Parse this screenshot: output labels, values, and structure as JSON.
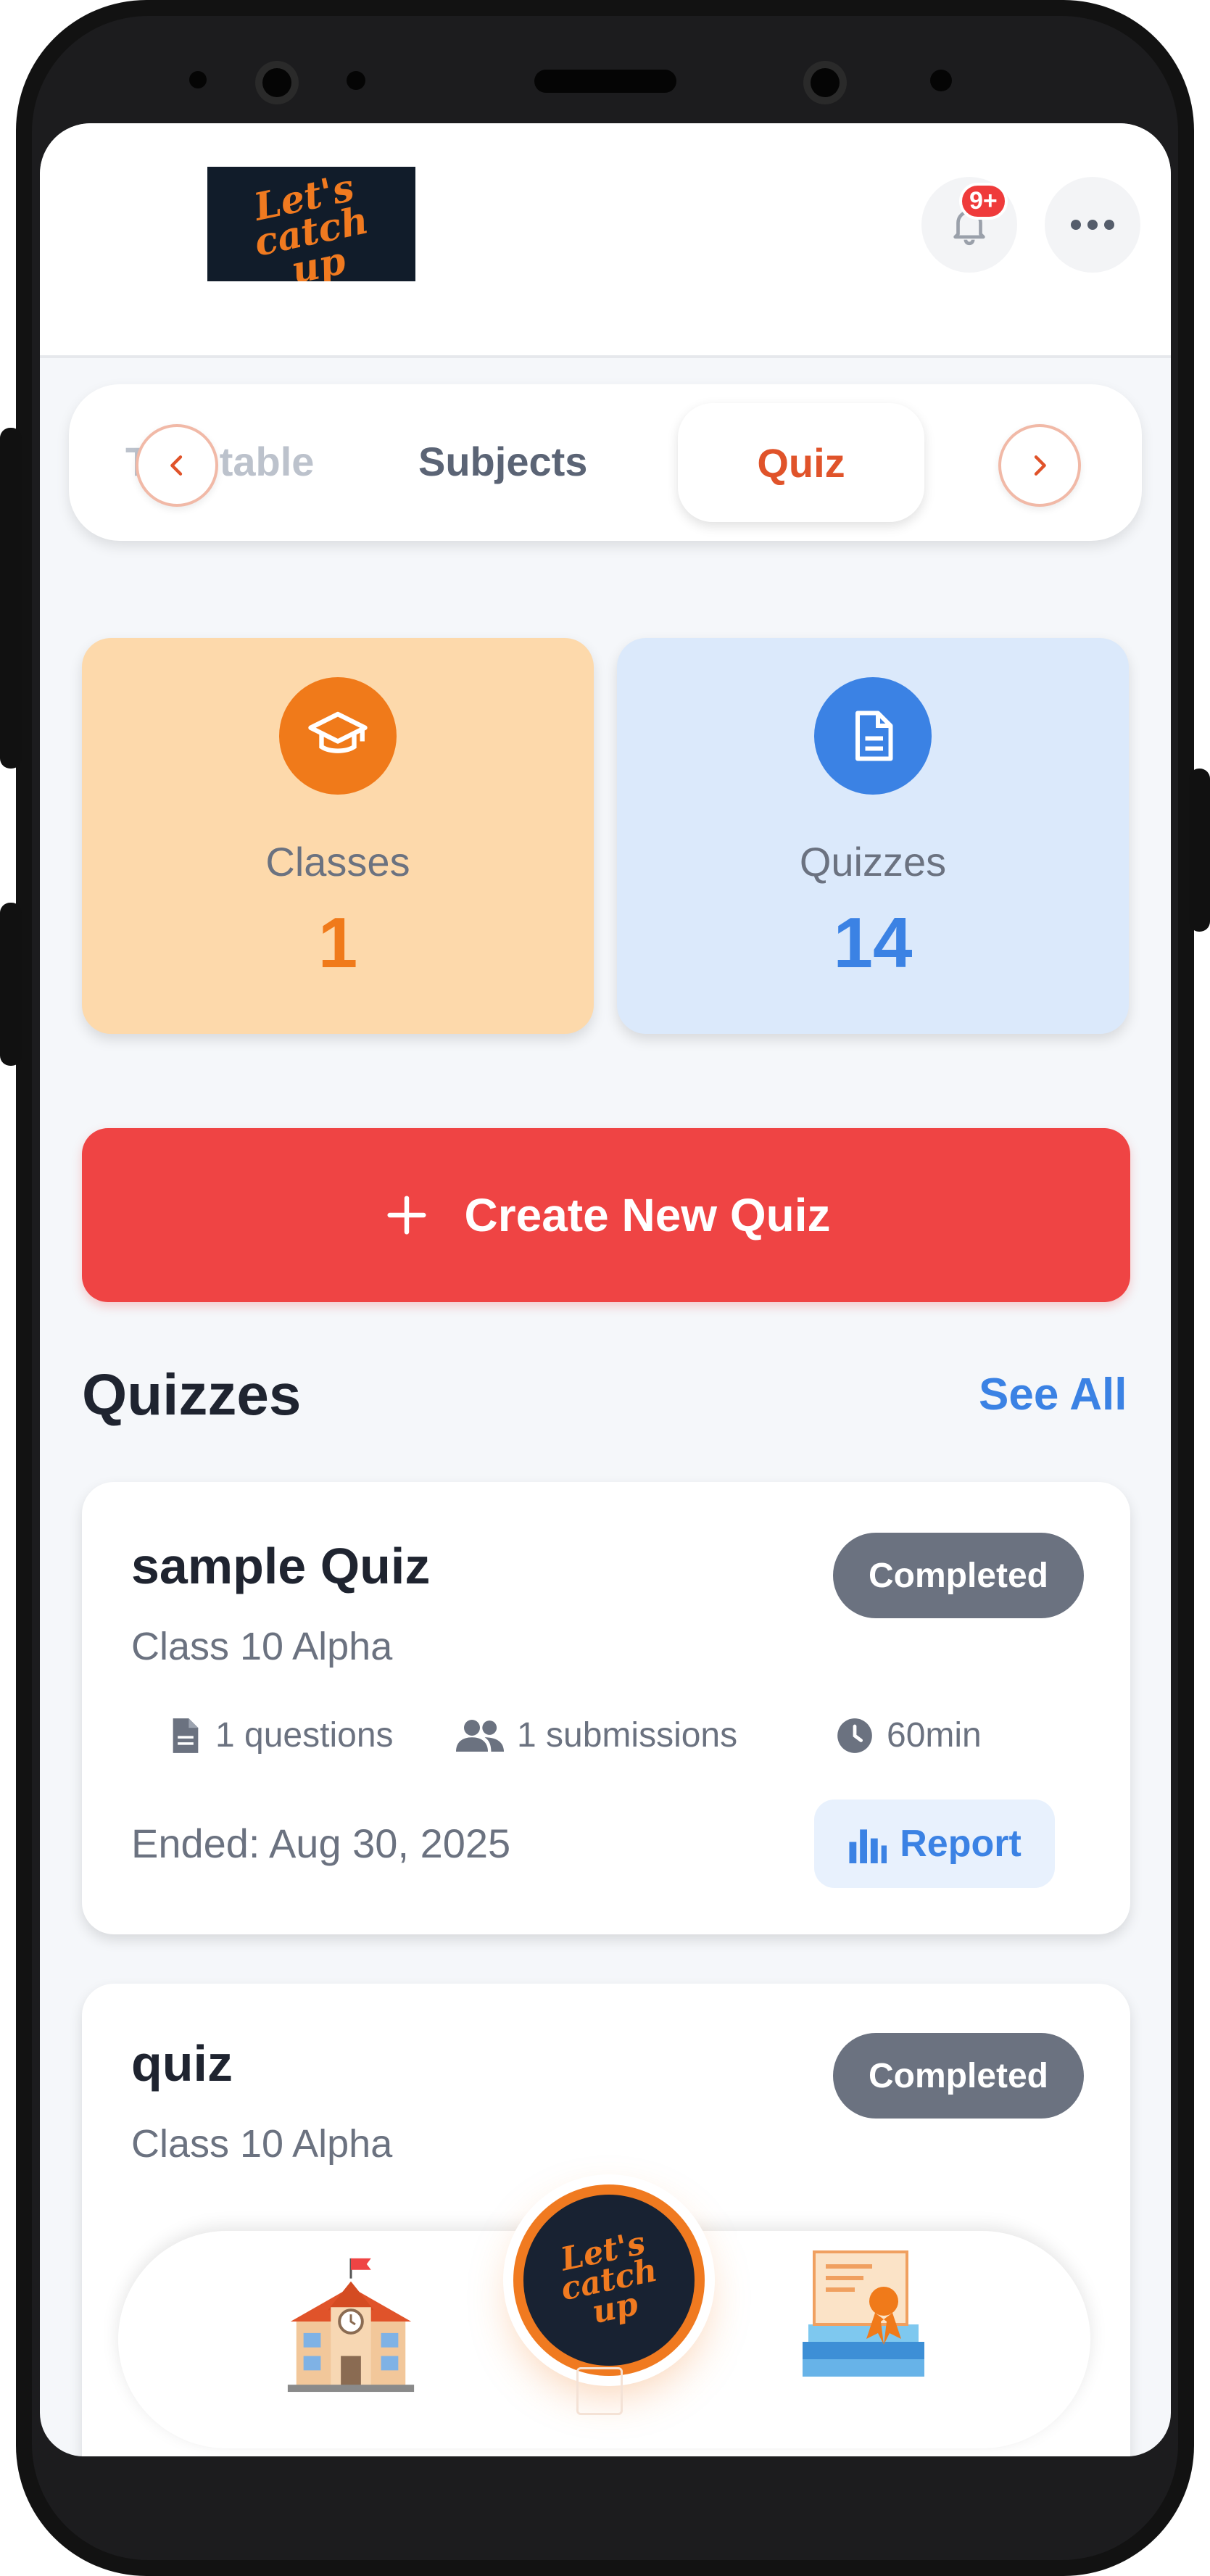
{
  "header": {
    "logo_text_line1": "Let's",
    "logo_text_line2": "catch",
    "logo_text_line3": "up",
    "notification_badge": "9+",
    "more_icon": "more-horizontal-icon",
    "bell_icon": "bell-icon"
  },
  "tabs": {
    "items": [
      "Timetable",
      "Subjects",
      "Quiz"
    ],
    "active": "Quiz",
    "prev_icon": "chevron-left-icon",
    "next_icon": "chevron-right-icon"
  },
  "stats": {
    "classes": {
      "label": "Classes",
      "value": "1",
      "icon": "graduation-cap-icon",
      "color": "#f07a1a",
      "bg": "#fdd9ab"
    },
    "quizzes": {
      "label": "Quizzes",
      "value": "14",
      "icon": "document-icon",
      "color": "#3b82e4",
      "bg": "#dbe9fb"
    }
  },
  "create_button": {
    "label": "Create New Quiz",
    "icon": "plus-icon"
  },
  "quizzes_section": {
    "title": "Quizzes",
    "see_all": "See All"
  },
  "quiz_cards": [
    {
      "title": "sample Quiz",
      "class": "Class 10 Alpha",
      "status": "Completed",
      "questions": "1 questions",
      "submissions": "1 submissions",
      "duration": "60min",
      "ended": "Ended: Aug 30, 2025",
      "report_label": "Report"
    },
    {
      "title": "quiz",
      "class": "Class 10 Alpha",
      "status": "Completed"
    }
  ],
  "colors": {
    "accent_red": "#ef4444",
    "accent_orange": "#e0532a",
    "link_blue": "#3b82e4"
  },
  "bottom_nav": {
    "left_icon": "school-building-icon",
    "center_icon": "app-logo-icon",
    "right_icon": "certificate-books-icon"
  }
}
